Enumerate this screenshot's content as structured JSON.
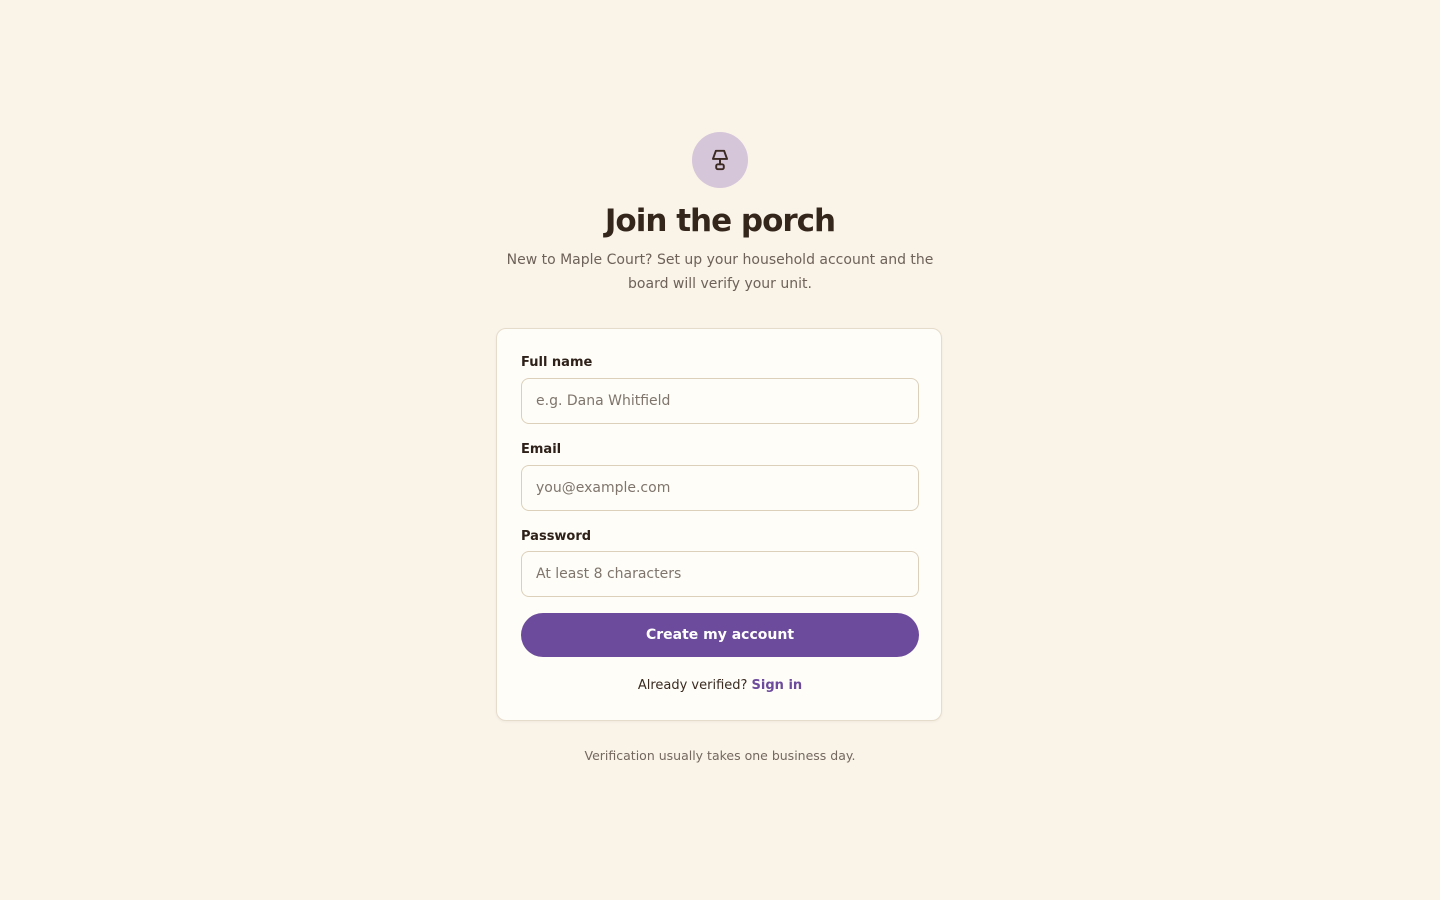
{
  "header": {
    "logo_icon": "lamp-icon",
    "title": "Join the porch",
    "subtitle": "New to Maple Court? Set up your household account and the board will verify your unit."
  },
  "form": {
    "full_name": {
      "label": "Full name",
      "placeholder": "e.g. Dana Whitfield",
      "value": ""
    },
    "email": {
      "label": "Email",
      "placeholder": "you@example.com",
      "value": ""
    },
    "password": {
      "label": "Password",
      "placeholder": "At least 8 characters",
      "value": ""
    },
    "submit_label": "Create my account",
    "signin_prompt": "Already verified?",
    "signin_link": "Sign in"
  },
  "footer": {
    "note": "Verification usually takes one business day."
  },
  "colors": {
    "background": "#f9f3e8",
    "card": "#fefdf8",
    "accent": "#6d4b9c",
    "logo_circle": "#d6c6d9",
    "heading": "#35261c"
  }
}
